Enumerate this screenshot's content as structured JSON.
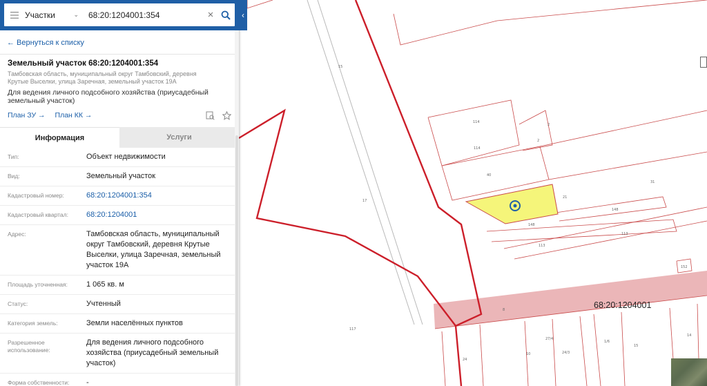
{
  "search": {
    "type_label": "Участки",
    "query": "68:20:1204001:354"
  },
  "back_label": "← Вернуться к списку",
  "object": {
    "title": "Земельный участок 68:20:1204001:354",
    "address_short": "Тамбовская область, муниципальный округ Тамбовский, деревня Крутые Выселки, улица Заречная, земельный участок 19А",
    "purpose": "Для ведения личного подсобного хозяйства (приусадебный земельный участок)",
    "plan_zu": "План ЗУ →",
    "plan_kk": "План КК →"
  },
  "tabs": {
    "info": "Информация",
    "services": "Услуги"
  },
  "properties": [
    {
      "label": "Тип:",
      "value": "Объект недвижимости"
    },
    {
      "label": "Вид:",
      "value": "Земельный участок"
    },
    {
      "label": "Кадастровый номер:",
      "value": "68:20:1204001:354"
    },
    {
      "label": "Кадастровый квартал:",
      "value": "68:20:1204001"
    },
    {
      "label": "Адрес:",
      "value": "Тамбовская область, муниципальный округ Тамбовский, деревня Крутые Выселки, улица Заречная, земельный участок 19А"
    },
    {
      "label": "Площадь уточненная:",
      "value": "1 065 кв. м"
    },
    {
      "label": "Статус:",
      "value": "Учтенный"
    },
    {
      "label": "Категория земель:",
      "value": "Земли населённых пунктов"
    },
    {
      "label": "Разрешенное использование:",
      "value": "Для ведения личного подсобного хозяйства (приусадебный земельный участок)"
    },
    {
      "label": "Форма собственности:",
      "value": "-"
    }
  ],
  "map": {
    "quarter_label": "68:20:1204001",
    "parcel_labels": [
      "15",
      "17",
      "114",
      "114",
      "2",
      "2",
      "40",
      "21",
      "31",
      "148",
      "148",
      "113",
      "113",
      "152",
      "117",
      "24",
      "27/4",
      "24/3",
      "1/6",
      "10",
      "15",
      "14",
      "8"
    ]
  },
  "colors": {
    "accent": "#1f5fa6",
    "boundary": "#cc1f2a",
    "selected_parcel": "#f5f57a",
    "quarter_band": "#e8a9ab"
  }
}
